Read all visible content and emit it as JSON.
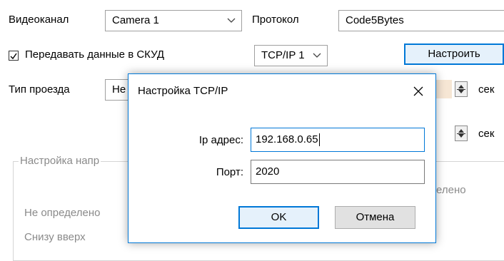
{
  "background": {
    "video_channel_label": "Видеоканал",
    "video_channel_value": "Camera 1",
    "protocol_label": "Протокол",
    "protocol_value": "Code5Bytes",
    "send_to_acs_label": "Передавать данные в СКУД",
    "send_to_acs_checked": true,
    "tcp_select_value": "TCP/IP 1",
    "configure_button": "Настроить",
    "pass_type_label": "Тип проезда",
    "pass_type_value_partial": "Не",
    "sec_label_1": "сек",
    "sec_label_2": "сек",
    "direction_group_label": "Настройка напр",
    "undefined_1": "Не определено",
    "undefined_right_partial": "елено",
    "bottom_up": "Снизу вверх"
  },
  "dialog": {
    "title": "Настройка TCP/IP",
    "ip_label": "Ip адрес:",
    "ip_value": "192.168.0.65",
    "port_label": "Порт:",
    "port_value": "2020",
    "ok_button": "OK",
    "cancel_button": "Отмена"
  },
  "colors": {
    "accent": "#0078d7",
    "button_bg": "#e1e1e1",
    "disabled_text": "#8a8a8a",
    "orange_tint": "#f6e6d4"
  }
}
